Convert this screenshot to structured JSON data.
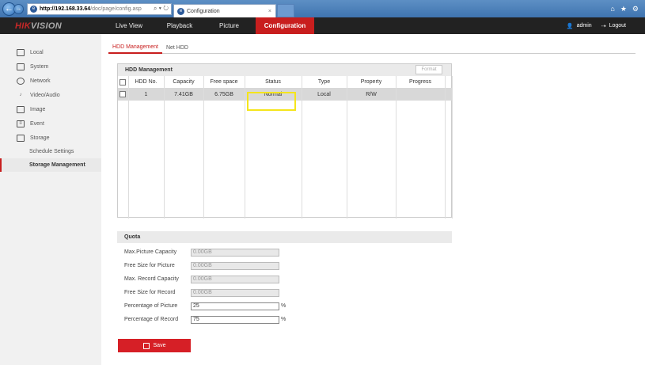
{
  "browser": {
    "url_host": "http://192.168.33.64",
    "url_path": "/doc/page/config.asp",
    "search_tools": "⌕ ▾ ↻",
    "tab_title": "Configuration",
    "tab_close": "×"
  },
  "app": {
    "logo_red": "HIK",
    "logo_grey": "VISION",
    "nav": [
      "Live View",
      "Playback",
      "Picture",
      "Configuration"
    ],
    "active_nav": "Configuration",
    "user": "admin",
    "logout": "Logout"
  },
  "sidebar": {
    "items": [
      {
        "label": "Local",
        "icon": "monitor-icon"
      },
      {
        "label": "System",
        "icon": "system-icon"
      },
      {
        "label": "Network",
        "icon": "globe-icon"
      },
      {
        "label": "Video/Audio",
        "icon": "video-audio-icon"
      },
      {
        "label": "Image",
        "icon": "image-icon"
      },
      {
        "label": "Event",
        "icon": "event-icon"
      },
      {
        "label": "Storage",
        "icon": "storage-icon"
      }
    ],
    "subitems": [
      "Schedule Settings",
      "Storage Management"
    ],
    "active_subitem": "Storage Management"
  },
  "subtabs": [
    "HDD Management",
    "Net HDD"
  ],
  "hdd": {
    "title": "HDD Management",
    "format_label": "Format",
    "columns": [
      "HDD No.",
      "Capacity",
      "Free space",
      "Status",
      "Type",
      "Property",
      "Progress"
    ],
    "rows": [
      {
        "no": "1",
        "capacity": "7.41GB",
        "free": "6.75GB",
        "status": "Normal",
        "type": "Local",
        "property": "R/W",
        "progress": ""
      }
    ]
  },
  "quota": {
    "title": "Quota",
    "fields": [
      {
        "label": "Max.Picture Capacity",
        "value": "0.00GB",
        "unit": ""
      },
      {
        "label": "Free Size for Picture",
        "value": "0.00GB",
        "unit": ""
      },
      {
        "label": "Max. Record Capacity",
        "value": "0.00GB",
        "unit": ""
      },
      {
        "label": "Free Size for Record",
        "value": "0.00GB",
        "unit": ""
      },
      {
        "label": "Percentage of Picture",
        "value": "25",
        "unit": "%"
      },
      {
        "label": "Percentage of Record",
        "value": "75",
        "unit": "%"
      }
    ]
  },
  "save_label": "Save"
}
